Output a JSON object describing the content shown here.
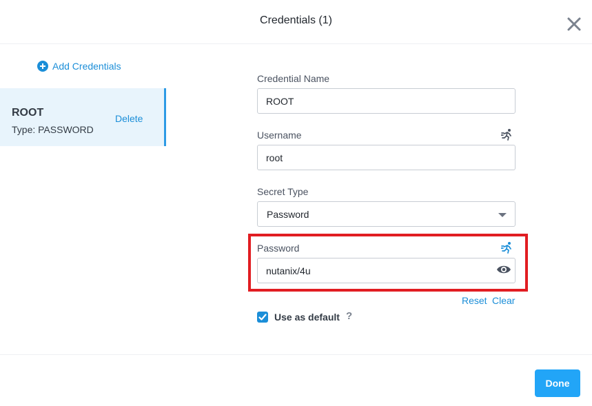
{
  "dialog": {
    "title": "Credentials (1)"
  },
  "sidebar": {
    "add_label": "Add Credentials",
    "credentials": [
      {
        "name": "ROOT",
        "type_label": "Type: PASSWORD",
        "delete_label": "Delete"
      }
    ]
  },
  "form": {
    "credential_name": {
      "label": "Credential Name",
      "value": "ROOT"
    },
    "username": {
      "label": "Username",
      "value": "root"
    },
    "secret_type": {
      "label": "Secret Type",
      "value": "Password"
    },
    "password": {
      "label": "Password",
      "value": "nutanix/4u"
    },
    "reset_label": "Reset",
    "clear_label": "Clear",
    "default_checkbox": {
      "label": "Use as default",
      "checked": true,
      "help": "?"
    }
  },
  "footer": {
    "done_label": "Done"
  },
  "colors": {
    "accent": "#1b8ed8",
    "primary_button": "#22a5f7",
    "selected_bg": "#e8f4fc",
    "highlight_border": "#e11d22"
  },
  "icons": {
    "close": "close-icon",
    "add": "plus-circle-icon",
    "runtime_variable": "running-person-icon",
    "dropdown": "caret-down-icon",
    "reveal_password": "eye-icon",
    "checkbox": "checkmark-icon"
  }
}
